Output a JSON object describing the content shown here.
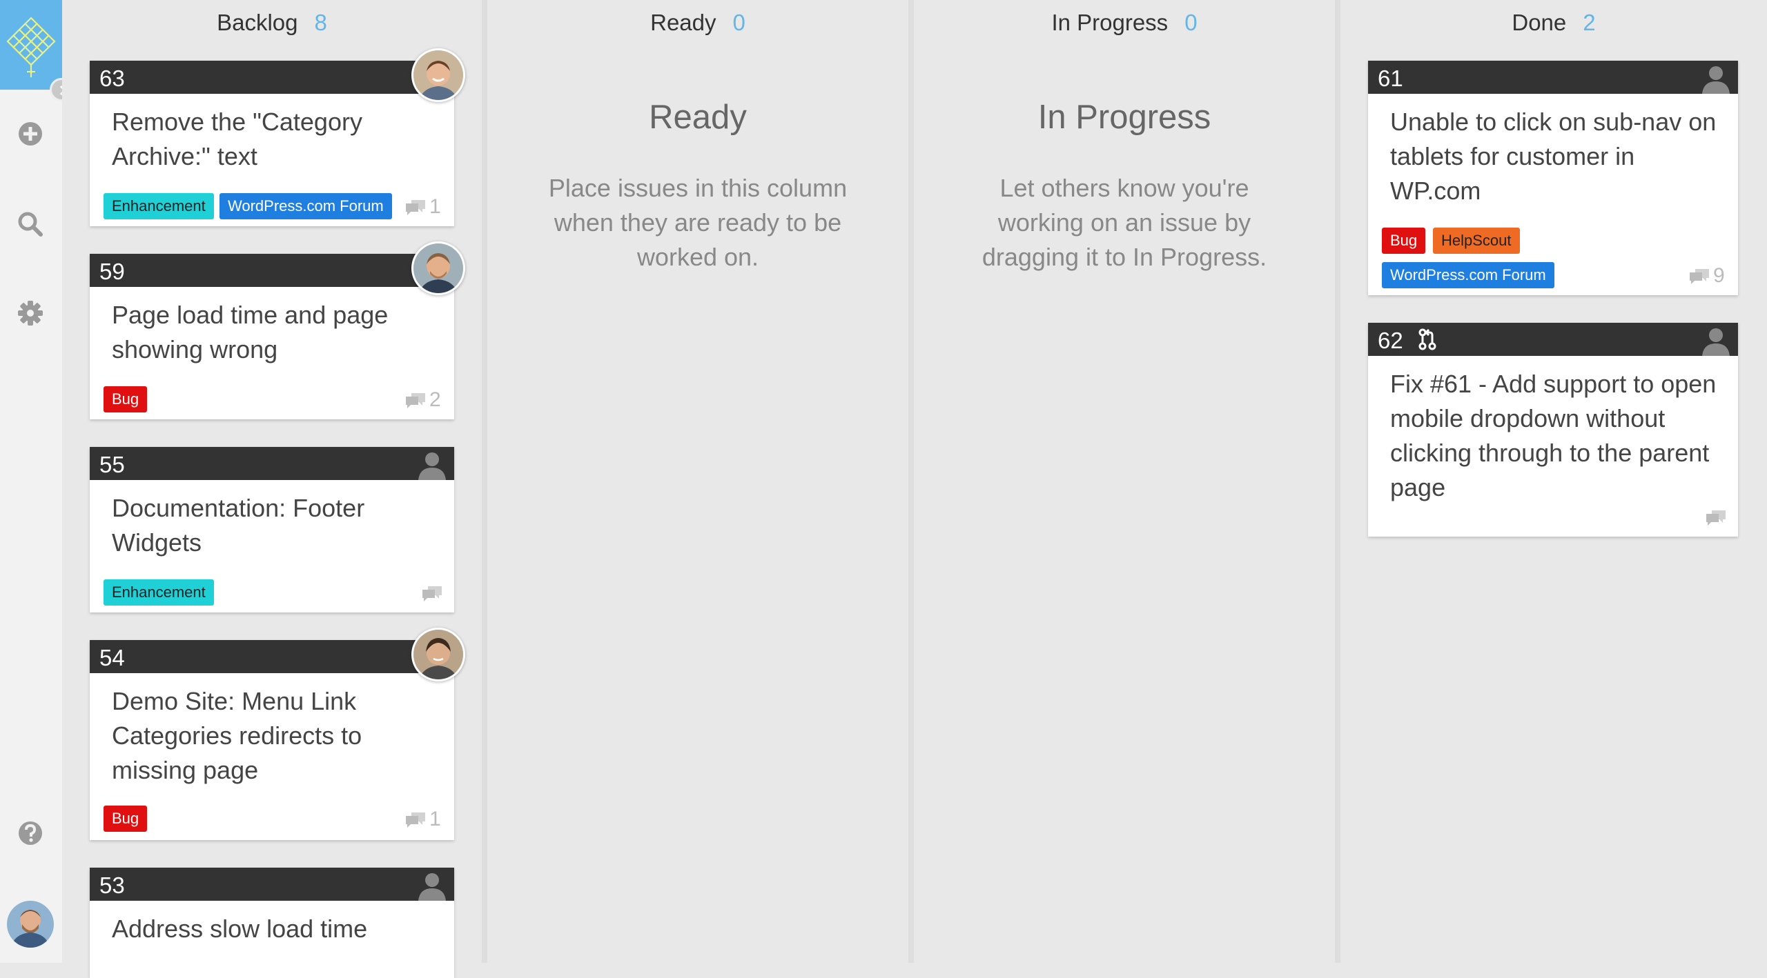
{
  "sidebar": {
    "logo_icon": "diamond-grid-logo",
    "icons": [
      "add-icon",
      "search-icon",
      "gear-icon",
      "help-icon"
    ]
  },
  "columns": {
    "backlog": {
      "name": "Backlog",
      "count": "8"
    },
    "ready": {
      "name": "Ready",
      "count": "0",
      "empty_title": "Ready",
      "empty_text": "Place issues in this column when they are ready to be worked on."
    },
    "in_progress": {
      "name": "In Progress",
      "count": "0",
      "empty_title": "In Progress",
      "empty_text": "Let others know you're working on an issue by dragging it to In Progress."
    },
    "done": {
      "name": "Done",
      "count": "2"
    }
  },
  "cards": {
    "c63": {
      "number": "63",
      "title": "Remove the \"Category Archive:\" text",
      "labels": [
        "Enhancement",
        "WordPress.com Forum"
      ],
      "comments": "1"
    },
    "c59": {
      "number": "59",
      "title": "Page load time and page showing wrong",
      "labels": [
        "Bug"
      ],
      "comments": "2"
    },
    "c55": {
      "number": "55",
      "title": "Documentation: Footer Widgets",
      "labels": [
        "Enhancement"
      ],
      "comments": ""
    },
    "c54": {
      "number": "54",
      "title": "Demo Site: Menu Link Categories redirects to missing page",
      "labels": [
        "Bug"
      ],
      "comments": "1"
    },
    "c53": {
      "number": "53",
      "title": "Address slow load time",
      "labels": [],
      "comments": ""
    },
    "c61": {
      "number": "61",
      "title": "Unable to click on sub-nav on tablets for customer in WP.com",
      "labels": [
        "Bug",
        "HelpScout",
        "WordPress.com Forum"
      ],
      "comments": "9"
    },
    "c62": {
      "number": "62",
      "title": "Fix #61 - Add support to open mobile dropdown without clicking through to the parent page",
      "labels": [],
      "comments": ""
    }
  },
  "colors": {
    "accent": "#62b6ea",
    "enhancement": "#1fd0d6",
    "wordpress_forum": "#1f7fe0",
    "bug": "#e01010",
    "helpscout": "#ef6a23"
  }
}
